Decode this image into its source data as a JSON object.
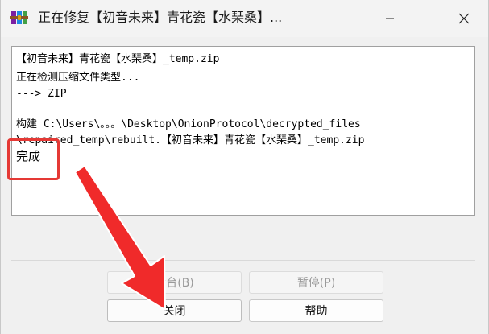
{
  "window": {
    "title": "正在修复【初音未来】青花瓷【水琹桑】..."
  },
  "log": {
    "lines": [
      "【初音未来】青花瓷【水琹桑】_temp.zip",
      "正在检测压缩文件类型...",
      "---> ZIP",
      "",
      "构建 C:\\Users\\。。。\\Desktop\\OnionProtocol\\decrypted_files",
      "\\repaired_temp\\rebuilt.【初音未来】青花瓷【水琹桑】_temp.zip",
      "完成"
    ]
  },
  "buttons": {
    "background": "后台(B)",
    "pause": "暂停(P)",
    "close": "关闭",
    "help": "帮助"
  },
  "colors": {
    "annotation": "#e53935",
    "window_bg": "#f0f0f0"
  },
  "icons": {
    "app": "winrar-icon",
    "minimize": "minimize-icon",
    "close": "close-icon"
  }
}
